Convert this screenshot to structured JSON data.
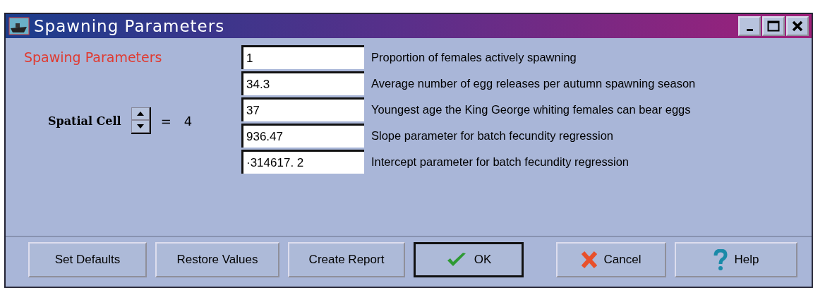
{
  "window": {
    "title": "Spawning Parameters"
  },
  "heading": "Spawing Parameters",
  "spatial_cell": {
    "label": "Spatial Cell",
    "equals": "=",
    "value": "4"
  },
  "parameters": [
    {
      "value": "1",
      "label": "Proportion of females actively spawning"
    },
    {
      "value": "34.3",
      "label": "Average number of egg releases per autumn spawning season"
    },
    {
      "value": "37",
      "label": "Youngest age the King George whiting females can bear eggs"
    },
    {
      "value": "936.47",
      "label": "Slope parameter for batch fecundity regression"
    },
    {
      "value": "·314617. 2",
      "label": "Intercept parameter for batch fecundity regression"
    }
  ],
  "buttons": [
    {
      "label": "Set Defaults",
      "kind": "plain",
      "selected": false
    },
    {
      "label": "Restore Values",
      "kind": "plain",
      "selected": false
    },
    {
      "label": "Create Report",
      "kind": "plain",
      "selected": false
    },
    {
      "label": "OK",
      "kind": "ok",
      "selected": true
    },
    {
      "label": "Cancel",
      "kind": "cancel",
      "selected": false
    },
    {
      "label": "Help",
      "kind": "help",
      "selected": false
    }
  ]
}
